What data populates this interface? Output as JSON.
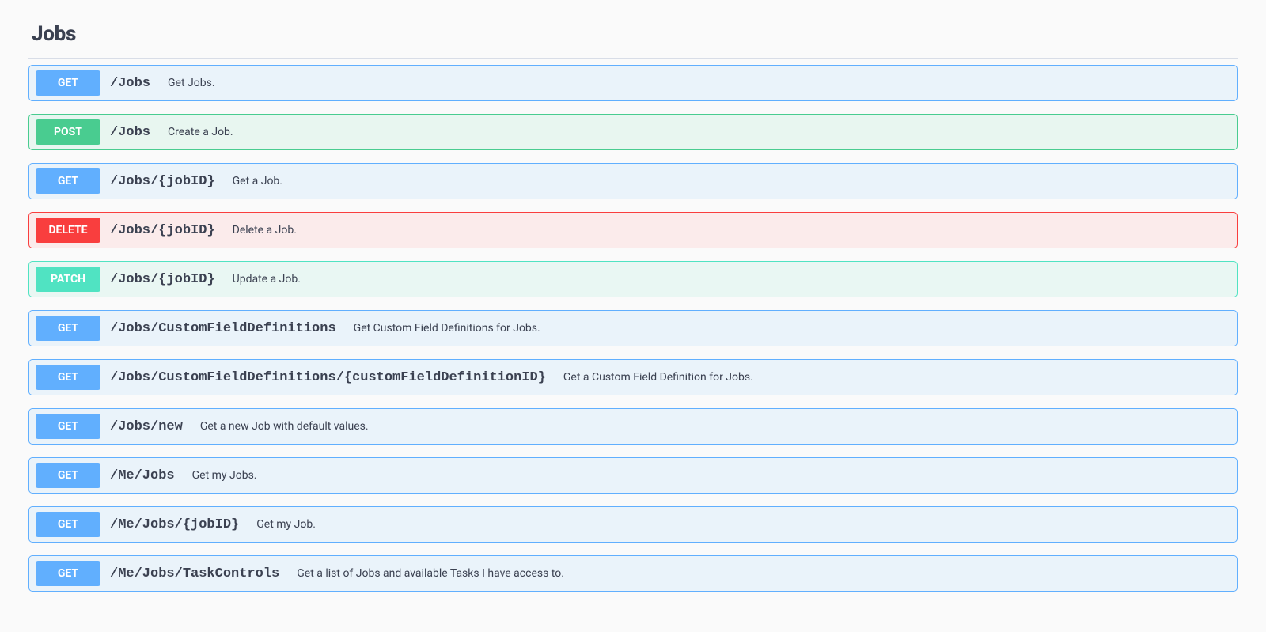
{
  "section": {
    "title": "Jobs"
  },
  "operations": [
    {
      "method": "GET",
      "path": "/Jobs",
      "desc": "Get Jobs."
    },
    {
      "method": "POST",
      "path": "/Jobs",
      "desc": "Create a Job."
    },
    {
      "method": "GET",
      "path": "/Jobs/{jobID}",
      "desc": "Get a Job."
    },
    {
      "method": "DELETE",
      "path": "/Jobs/{jobID}",
      "desc": "Delete a Job."
    },
    {
      "method": "PATCH",
      "path": "/Jobs/{jobID}",
      "desc": "Update a Job."
    },
    {
      "method": "GET",
      "path": "/Jobs/CustomFieldDefinitions",
      "desc": "Get Custom Field Definitions for Jobs."
    },
    {
      "method": "GET",
      "path": "/Jobs/CustomFieldDefinitions/{customFieldDefinitionID}",
      "desc": "Get a Custom Field Definition for Jobs."
    },
    {
      "method": "GET",
      "path": "/Jobs/new",
      "desc": "Get a new Job with default values."
    },
    {
      "method": "GET",
      "path": "/Me/Jobs",
      "desc": "Get my Jobs."
    },
    {
      "method": "GET",
      "path": "/Me/Jobs/{jobID}",
      "desc": "Get my Job."
    },
    {
      "method": "GET",
      "path": "/Me/Jobs/TaskControls",
      "desc": "Get a list of Jobs and available Tasks I have access to."
    }
  ]
}
